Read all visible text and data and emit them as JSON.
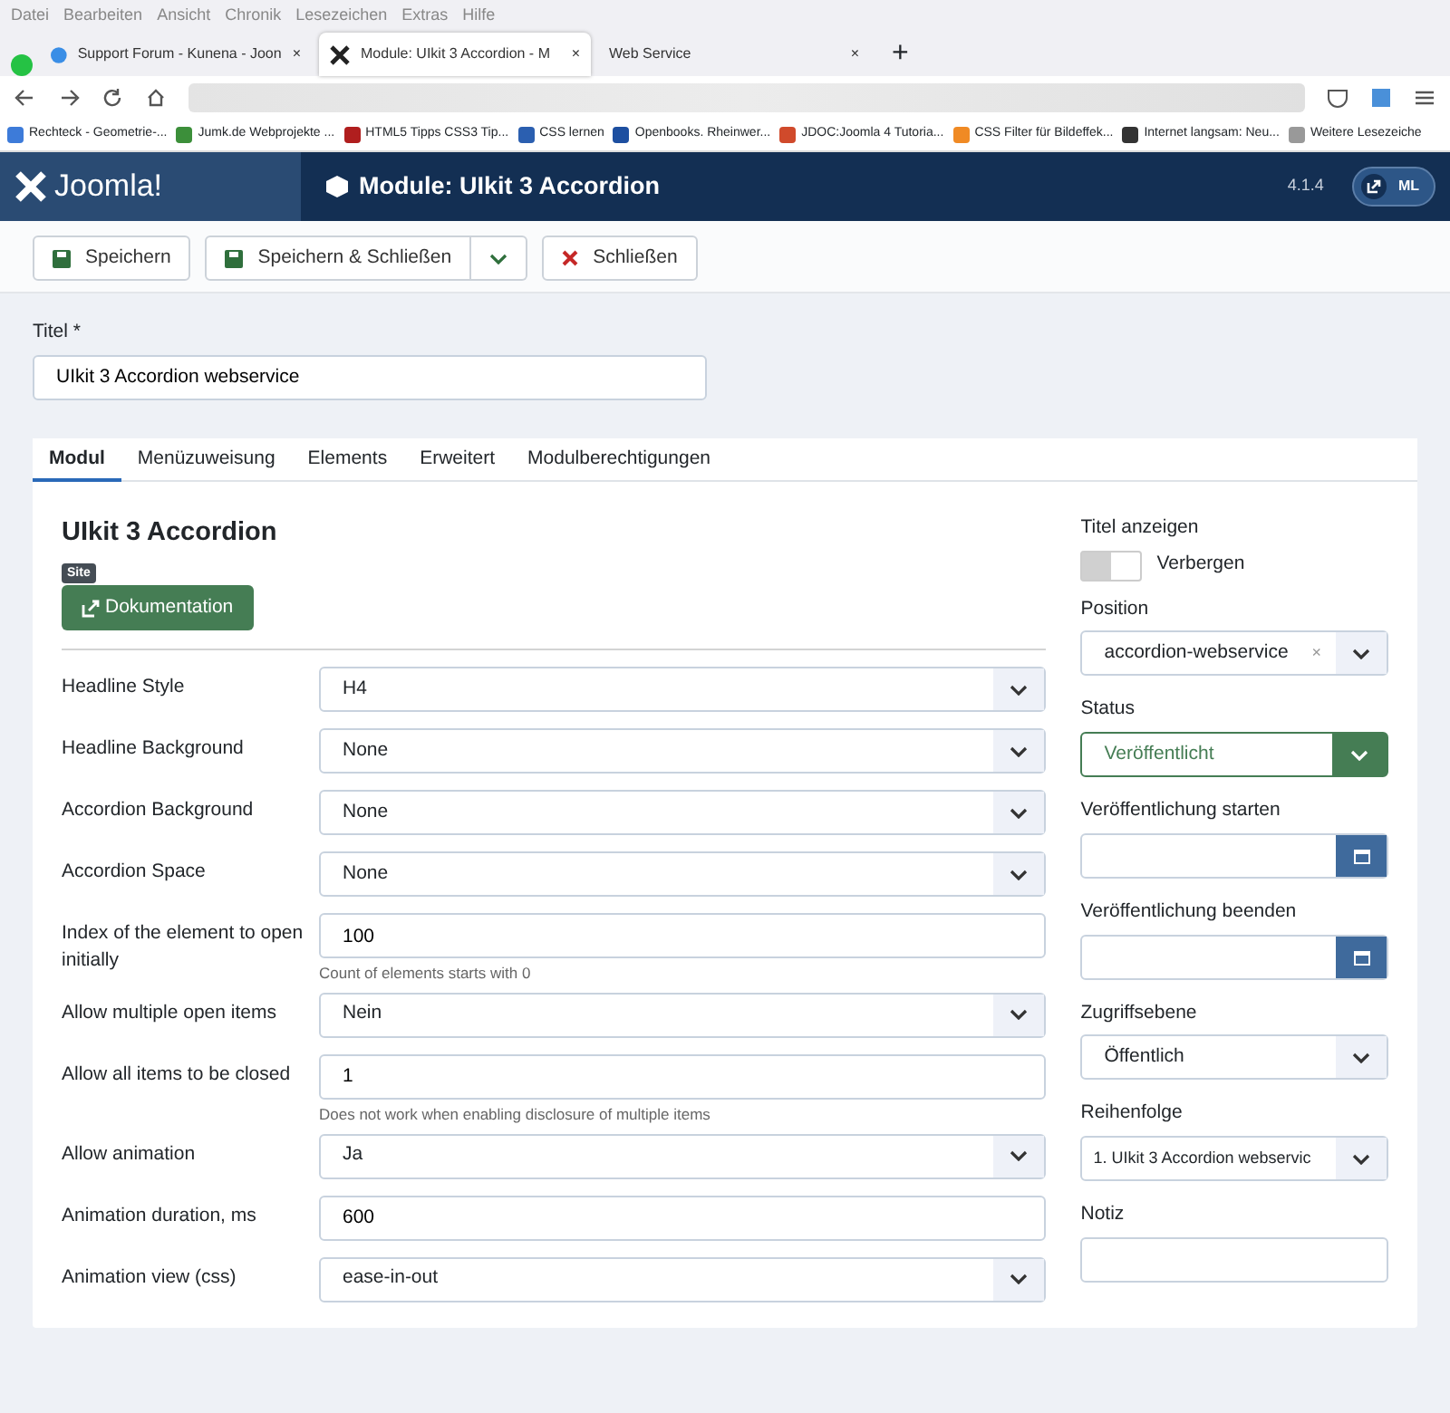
{
  "browser": {
    "menu": [
      "Datei",
      "Bearbeiten",
      "Ansicht",
      "Chronik",
      "Lesezeichen",
      "Extras",
      "Hilfe"
    ],
    "tabs": [
      {
        "label": "Support Forum - Kunena - Joon",
        "selected": false,
        "close": "×"
      },
      {
        "label": "Module: UIkit 3 Accordion - M",
        "selected": true,
        "close": "×"
      },
      {
        "label": "Web Service",
        "selected": false,
        "close": "×"
      }
    ],
    "new_tab": "+",
    "bookmarks": [
      "Rechteck - Geometrie-...",
      "Jumk.de Webprojekte ...",
      "HTML5 Tipps CSS3 Tip...",
      "CSS lernen",
      "Openbooks. Rheinwer...",
      "JDOC:Joomla 4 Tutoria...",
      "CSS Filter für Bildeffek...",
      "Internet langsam: Neu...",
      "Weitere Lesezeiche"
    ]
  },
  "header": {
    "logo": "Joomla!",
    "title": "Module: UIkit 3 Accordion",
    "version": "4.1.4",
    "user": "ML"
  },
  "toolbar": [
    {
      "kind": "save",
      "label": "Speichern"
    },
    {
      "kind": "save-close",
      "label": "Speichern & Schließen"
    },
    {
      "kind": "close",
      "label": "Schließen"
    }
  ],
  "title_field": {
    "label": "Titel *",
    "value": "UIkit 3 Accordion webservice"
  },
  "tabs": [
    {
      "label": "Modul",
      "selected": true
    },
    {
      "label": "Menüzuweisung",
      "selected": false
    },
    {
      "label": "Elements",
      "selected": false
    },
    {
      "label": "Erweitert",
      "selected": false
    },
    {
      "label": "Modulberechtigungen",
      "selected": false
    }
  ],
  "module": {
    "heading": "UIkit 3 Accordion",
    "badge": "Site",
    "doc_button": "Dokumentation"
  },
  "fields": [
    {
      "label": "Headline Style",
      "kind": "select",
      "value": "H4"
    },
    {
      "label": "Headline Background",
      "kind": "select",
      "value": "None"
    },
    {
      "label": "Accordion Background",
      "kind": "select",
      "value": "None"
    },
    {
      "label": "Accordion Space",
      "kind": "select",
      "value": "None"
    },
    {
      "label": "Index of the element to open initially",
      "kind": "text",
      "value": "100",
      "hint": "Count of elements starts with 0"
    },
    {
      "label": "Allow multiple open items",
      "kind": "select",
      "value": "Nein"
    },
    {
      "label": "Allow all items to be closed",
      "kind": "text",
      "value": "1",
      "hint": "Does not work when enabling disclosure of multiple items"
    },
    {
      "label": "Allow animation",
      "kind": "select",
      "value": "Ja"
    },
    {
      "label": "Animation duration, ms",
      "kind": "text",
      "value": "600"
    },
    {
      "label": "Animation view (css)",
      "kind": "select",
      "value": "ease-in-out"
    }
  ],
  "sidebar": {
    "show_title": {
      "label": "Titel anzeigen",
      "on": false,
      "state_label": "Verbergen"
    },
    "fields": [
      {
        "label": "Position",
        "kind": "choice",
        "value": "accordion-webservice",
        "clear": "×"
      },
      {
        "label": "Status",
        "kind": "status",
        "value": "Veröffentlicht"
      },
      {
        "label": "Veröffentlichung starten",
        "kind": "date"
      },
      {
        "label": "Veröffentlichung beenden",
        "kind": "date"
      },
      {
        "label": "Zugriffsebene",
        "kind": "select",
        "value": "Öffentlich"
      },
      {
        "label": "Reihenfolge",
        "kind": "select",
        "value": "1. UIkit 3 Accordion webservic"
      },
      {
        "label": "Notiz",
        "kind": "text"
      }
    ]
  }
}
